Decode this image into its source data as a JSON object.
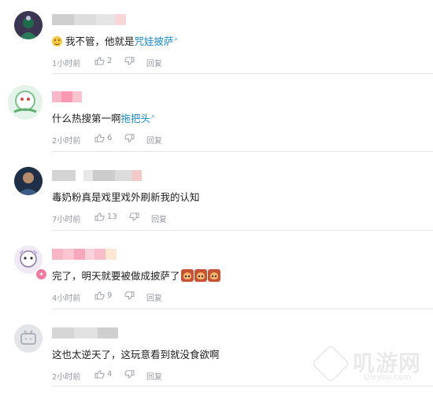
{
  "comments": [
    {
      "text_prefix": "我不管，他就是",
      "link": "咒娃披萨",
      "time": "1小时前",
      "likes": "2",
      "reply": "回复"
    },
    {
      "text_prefix": "什么热搜第一啊",
      "link": "拖把头",
      "time": "2小时前",
      "likes": "6",
      "reply": "回复"
    },
    {
      "text_prefix": "毒奶粉真是戏里戏外刷新我的认知",
      "link": "",
      "time": "7小时前",
      "likes": "13",
      "reply": "回复"
    },
    {
      "text_prefix": "完了，明天就要被做成披萨了",
      "link": "",
      "time": "4小时前",
      "likes": "9",
      "reply": "回复"
    },
    {
      "text_prefix": "这也太逆天了，这玩意看到就没食欲啊",
      "link": "",
      "time": "2小时前",
      "likes": "4",
      "reply": "回复"
    }
  ],
  "icons": {
    "like": "thumbs-up-icon",
    "search_mark": "search-icon"
  },
  "colors": {
    "link": "#178bcf",
    "meta": "#9499a0",
    "vip_name": "#fb7299"
  },
  "watermark": {
    "title": "叽游网",
    "site": "Qleyou.com"
  }
}
